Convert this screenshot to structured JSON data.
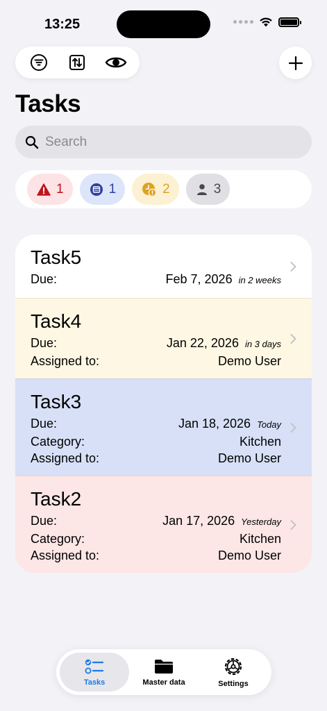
{
  "status": {
    "time": "13:25"
  },
  "toolbar": {
    "icons": [
      "filter-icon",
      "sort-icon",
      "eye-icon"
    ],
    "add_icon": "plus-icon"
  },
  "page": {
    "title": "Tasks"
  },
  "search": {
    "placeholder": "Search",
    "value": ""
  },
  "filters": [
    {
      "icon": "warning-icon",
      "count": "1",
      "color": "#c0141c"
    },
    {
      "icon": "calendar-icon",
      "count": "1",
      "color": "#2d3fa5"
    },
    {
      "icon": "clock-alert-icon",
      "count": "2",
      "color": "#dda324"
    },
    {
      "icon": "person-icon",
      "count": "3",
      "color": "#48484c"
    }
  ],
  "tasks": [
    {
      "name": "Task5",
      "due_label": "Due:",
      "due_date": "Feb 7, 2026",
      "due_relative": "in 2 weeks",
      "background": "#ffffff"
    },
    {
      "name": "Task4",
      "due_label": "Due:",
      "due_date": "Jan 22, 2026",
      "due_relative": "in 3 days",
      "assigned_label": "Assigned to:",
      "assigned_value": "Demo User",
      "background": "#fdf7e3"
    },
    {
      "name": "Task3",
      "due_label": "Due:",
      "due_date": "Jan 18, 2026",
      "due_relative": "Today",
      "category_label": "Category:",
      "category_value": "Kitchen",
      "assigned_label": "Assigned to:",
      "assigned_value": "Demo User",
      "background": "#d7e0f7"
    },
    {
      "name": "Task2",
      "due_label": "Due:",
      "due_date": "Jan 17, 2026",
      "due_relative": "Yesterday",
      "category_label": "Category:",
      "category_value": "Kitchen",
      "assigned_label": "Assigned to:",
      "assigned_value": "Demo User",
      "background": "#fde6e6"
    }
  ],
  "tabbar": {
    "tasks_label": "Tasks",
    "master_label": "Master data",
    "settings_label": "Settings",
    "accent": "#1a7ae8"
  }
}
